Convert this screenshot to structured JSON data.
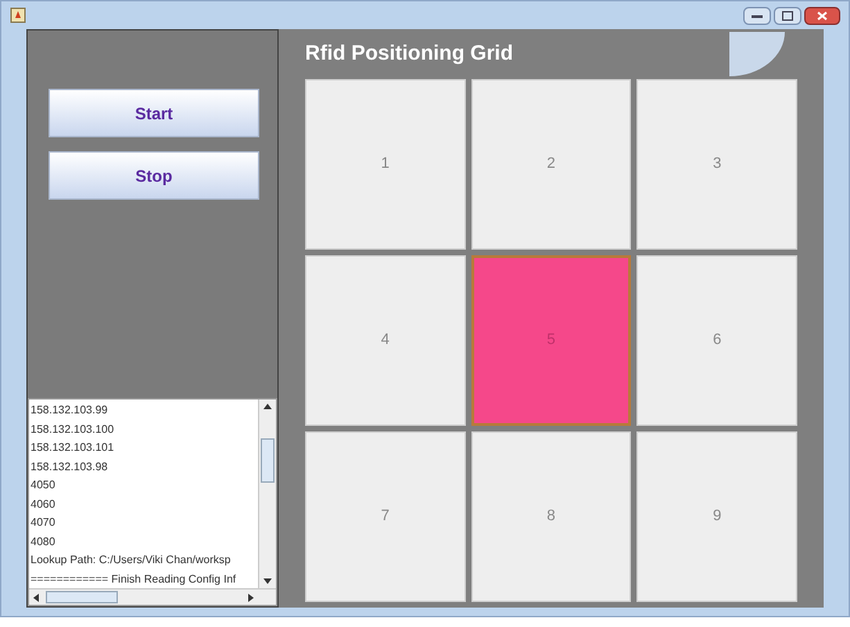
{
  "controls": {
    "buttons": [
      "Start",
      "Stop"
    ]
  },
  "log": {
    "lines": [
      "158.132.103.99",
      "158.132.103.100",
      "158.132.103.101",
      "158.132.103.98",
      "4050",
      "4060",
      "4070",
      "4080",
      "Lookup Path: C:/Users/Viki Chan/worksp",
      "============ Finish Reading Config Inf"
    ]
  },
  "grid": {
    "title": "Rfid Positioning Grid",
    "cells": [
      {
        "label": "1",
        "selected": false
      },
      {
        "label": "2",
        "selected": false
      },
      {
        "label": "3",
        "selected": false
      },
      {
        "label": "4",
        "selected": false
      },
      {
        "label": "5",
        "selected": true
      },
      {
        "label": "6",
        "selected": false
      },
      {
        "label": "7",
        "selected": false
      },
      {
        "label": "8",
        "selected": false
      },
      {
        "label": "9",
        "selected": false
      }
    ]
  }
}
